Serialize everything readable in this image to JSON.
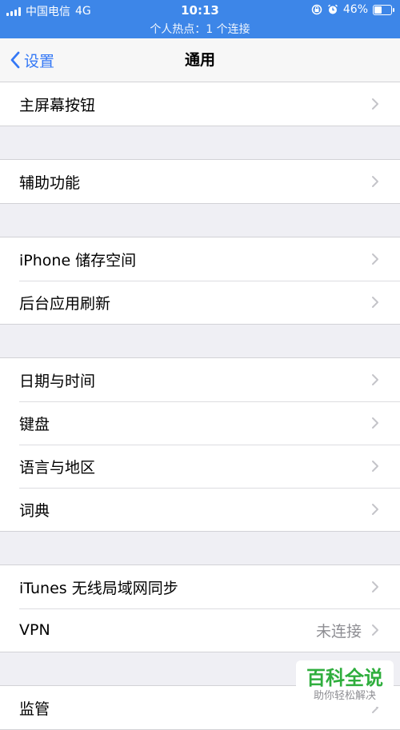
{
  "status_bar": {
    "carrier": "中国电信",
    "network": "4G",
    "time": "10:13",
    "battery": "46%",
    "battery_level": 0.46,
    "hotspot_text": "个人热点：1 个连接",
    "background_color": "#3d86e8"
  },
  "nav": {
    "back_label": "设置",
    "title": "通用"
  },
  "groups": [
    {
      "rows": [
        {
          "label": "主屏幕按钮"
        }
      ]
    },
    {
      "rows": [
        {
          "label": "辅助功能"
        }
      ]
    },
    {
      "rows": [
        {
          "label": "iPhone 储存空间"
        },
        {
          "label": "后台应用刷新"
        }
      ]
    },
    {
      "rows": [
        {
          "label": "日期与时间"
        },
        {
          "label": "键盘"
        },
        {
          "label": "语言与地区"
        },
        {
          "label": "词典"
        }
      ]
    },
    {
      "rows": [
        {
          "label": "iTunes 无线局域网同步"
        },
        {
          "label": "VPN",
          "value": "未连接"
        }
      ]
    },
    {
      "rows": [
        {
          "label": "监管"
        }
      ]
    }
  ],
  "watermark": {
    "title": "百科全说",
    "subtitle": "助你轻松解决"
  },
  "colors": {
    "accent": "#3478f6",
    "background": "#efeff4",
    "watermark_green": "#2fae3d"
  }
}
